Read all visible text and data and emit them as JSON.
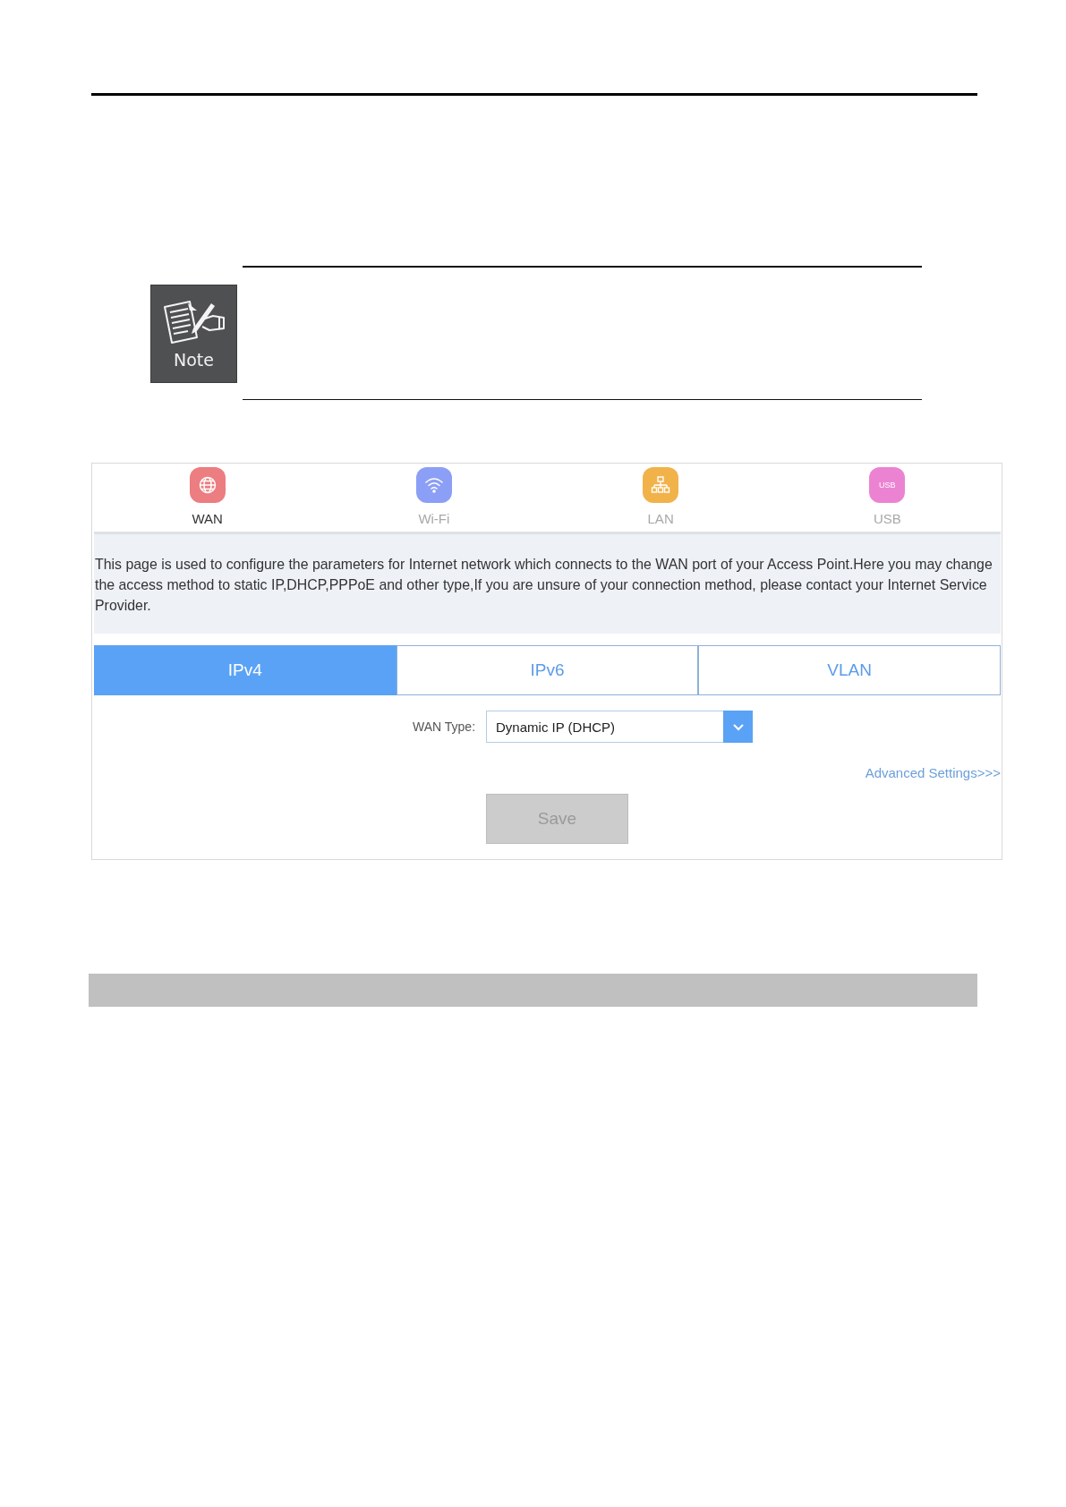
{
  "note": {
    "badge_label": "Note"
  },
  "router_ui": {
    "nav": [
      {
        "label": "WAN",
        "kind": "globe",
        "color": "#ec7d80",
        "selected": true
      },
      {
        "label": "Wi-Fi",
        "kind": "wifi",
        "color": "#8c9ff6",
        "selected": false
      },
      {
        "label": "LAN",
        "kind": "network",
        "color": "#f2b24a",
        "selected": false
      },
      {
        "label": "USB",
        "kind": "usb",
        "icon_text": "USB",
        "color": "#ec83d2",
        "selected": false
      }
    ],
    "description": "This page is used to configure the parameters for Internet network which connects to the WAN port of your Access Point.Here you may change the access method to static IP,DHCP,PPPoE and other type,If you are unsure of your connection method, please contact your Internet Service Provider.",
    "tabs": [
      {
        "label": "IPv4",
        "selected": true
      },
      {
        "label": "IPv6",
        "selected": false
      },
      {
        "label": "VLAN",
        "selected": false
      }
    ],
    "wan_type": {
      "label": "WAN Type:",
      "value": "Dynamic IP (DHCP)"
    },
    "advanced_link": "Advanced Settings>>>",
    "save_button": {
      "label": "Save",
      "disabled": true
    }
  }
}
